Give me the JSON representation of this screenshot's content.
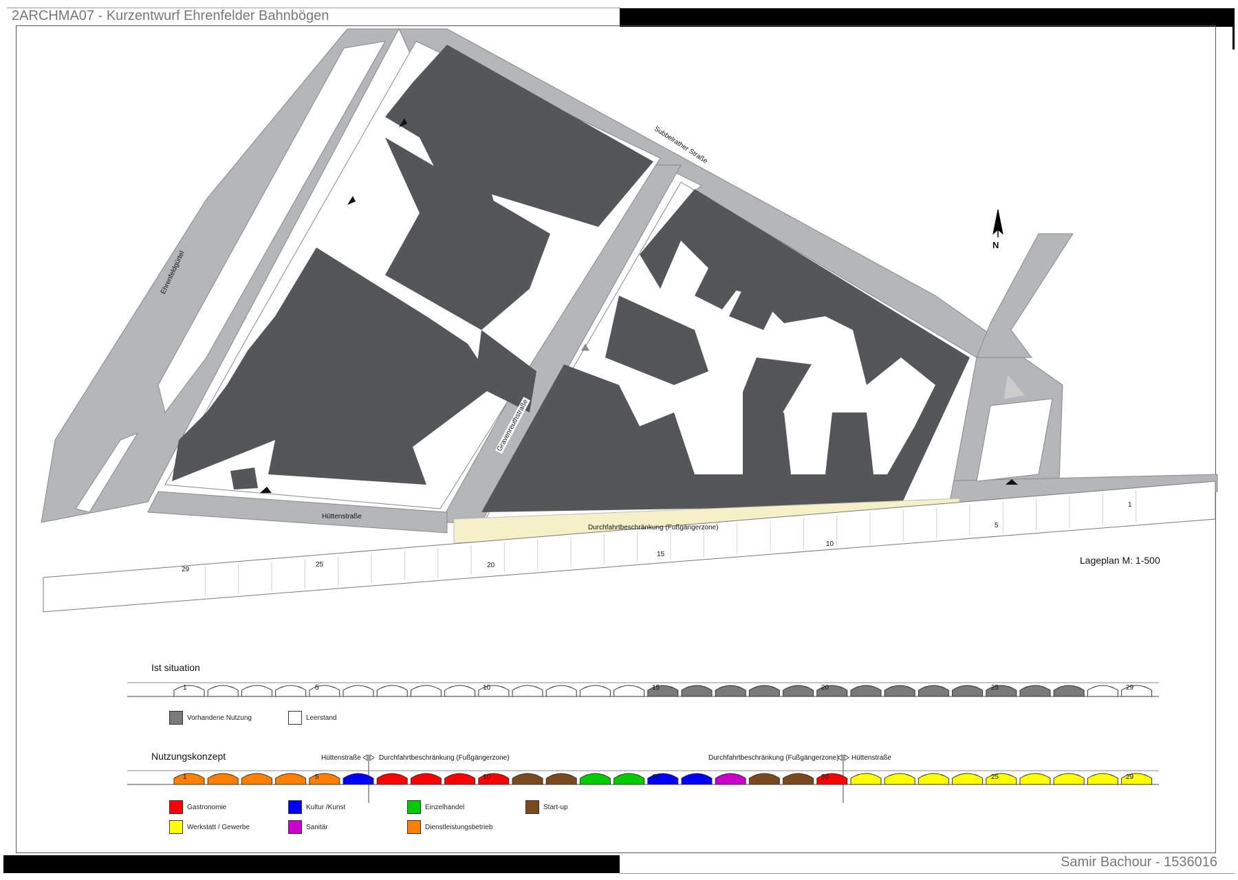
{
  "header": {
    "title": "2ARCHMA07 - Kurzentwurf Ehrenfelder Bahnbögen"
  },
  "footer": {
    "author": "Samir Bachour - 1536016"
  },
  "plan": {
    "streets": {
      "ehrenfeldguertel": "Ehrenfeldgürtel",
      "subbelrather": "Subbelrather Straße",
      "gravenreuth": "Gravenreuthstraße",
      "huetten": "Hüttenstraße",
      "zone": "Durchfahrtbeschränkung (Fußgängerzone)"
    },
    "north": "N",
    "scale": "Lageplan M: 1-500",
    "arch_numbers": [
      "1",
      "5",
      "10",
      "15",
      "20",
      "25",
      "29"
    ],
    "colors": {
      "building": "#555658",
      "street": "#b5b6b8",
      "zone": "#f5f0c8"
    }
  },
  "ist": {
    "title": "Ist situation",
    "numbers": [
      "1",
      "5",
      "10",
      "15",
      "20",
      "25",
      "29"
    ],
    "legend": [
      {
        "label": "Vorhandene Nutzung",
        "color": "#7a7a7a"
      },
      {
        "label": "Leerstand",
        "color": "#ffffff"
      }
    ]
  },
  "konzept": {
    "title": "Nutzungskonzept",
    "annotations": {
      "left_street": "Hüttenstraße",
      "left_zone": "Durchfahrtbeschränkung (Fußgängerzone)",
      "right_zone": "Durchfahrtbeschränkung (Fußgängerzone)",
      "right_street": "Hüttenstraße"
    },
    "numbers": [
      "1",
      "5",
      "10",
      "15",
      "20",
      "25",
      "29"
    ],
    "legend": [
      {
        "label": "Gastronomie",
        "color": "#ff0000"
      },
      {
        "label": "Kultur /Kunst",
        "color": "#0000ff"
      },
      {
        "label": "Einzelhandel",
        "color": "#00cc00"
      },
      {
        "label": "Start-up",
        "color": "#7a4a1e"
      },
      {
        "label": "Werkstatt / Gewerbe",
        "color": "#ffff00"
      },
      {
        "label": "Sanitär",
        "color": "#cc00cc"
      },
      {
        "label": "Dienstleistungsbetrieb",
        "color": "#ff8000"
      }
    ]
  }
}
